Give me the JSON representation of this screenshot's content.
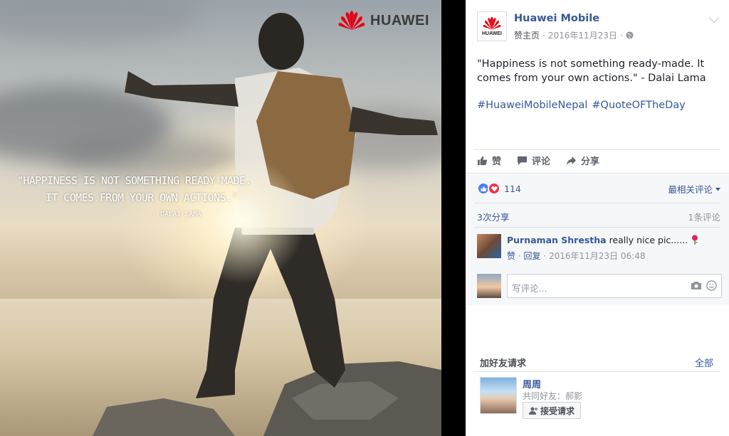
{
  "photo": {
    "brand": "HUAWEI",
    "quote_line1": "\"Happiness is not something ready-made.",
    "quote_line2": "It comes from your own actions.\"",
    "quote_author": "- Dalai Lama"
  },
  "post": {
    "page_name": "Huawei Mobile",
    "avatar_text": "HUAWEI",
    "like_page": "赞主页",
    "dot": "·",
    "date": "2016年11月23日",
    "dot2": "·",
    "text": "\"Happiness is not something ready-made. It comes from your own actions.\" - Dalai Lama",
    "hashtags": [
      "#HuaweiMobileNepal",
      "#QuoteOFTheDay"
    ],
    "actions": {
      "like": "赞",
      "comment": "评论",
      "share": "分享"
    }
  },
  "feedback": {
    "reaction_count": "114",
    "sort_label": "最相关评论",
    "shares": "3次分享",
    "comment_count": "1条评论",
    "comment": {
      "author": "Purnaman Shrestha",
      "text": "really nice pic......",
      "like": "赞",
      "sep": "·",
      "reply": "回复",
      "sep2": "·",
      "timestamp": "2016年11月23日 06:48"
    },
    "write_placeholder": "写评论..."
  },
  "friend_requests": {
    "title": "加好友请求",
    "see_all": "全部",
    "name": "周周",
    "mutual": "共同好友：郝影",
    "accept": "接受请求"
  },
  "colors": {
    "link": "#365899",
    "brand_red": "#e60012",
    "like_blue": "#4a7ff0",
    "love_red": "#f0334b"
  }
}
